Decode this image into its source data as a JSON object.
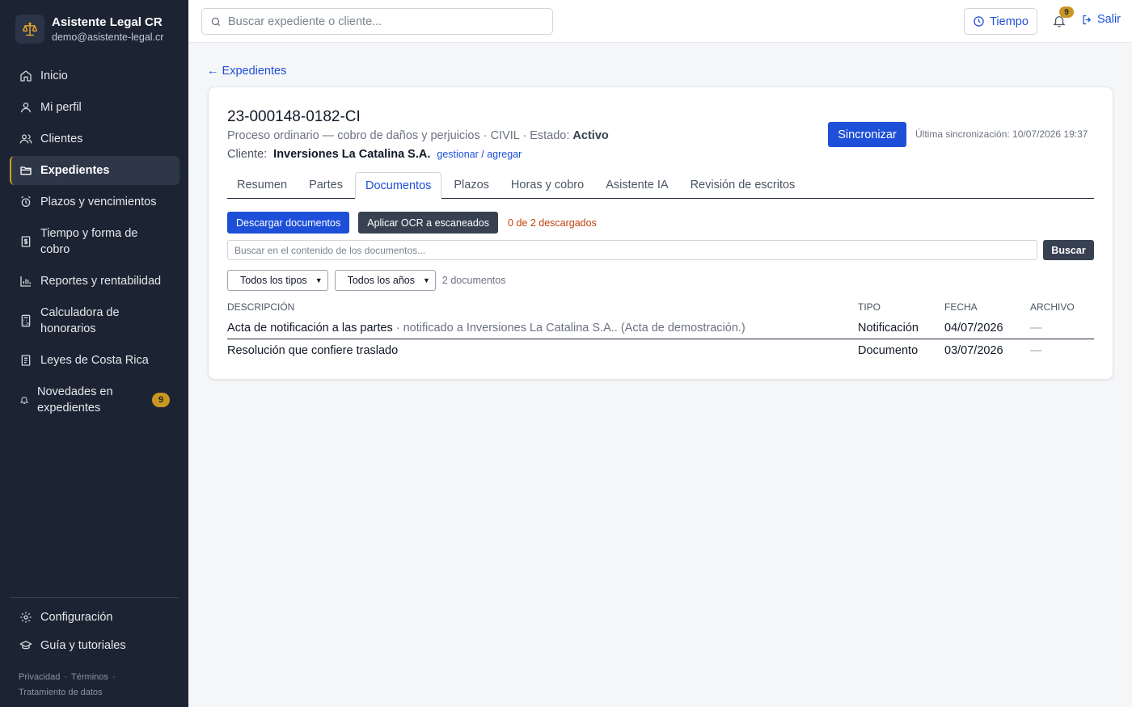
{
  "brand": {
    "title": "Asistente Legal CR",
    "email": "demo@asistente-legal.cr",
    "icon": "scale-icon"
  },
  "sidebar": {
    "items": [
      {
        "label": "Inicio",
        "icon": "home-icon"
      },
      {
        "label": "Mi perfil",
        "icon": "user-icon"
      },
      {
        "label": "Clientes",
        "icon": "users-icon"
      },
      {
        "label": "Expedientes",
        "icon": "folder-icon",
        "active": true
      },
      {
        "label": "Plazos y vencimientos",
        "icon": "alarm-clock-icon"
      },
      {
        "label": "Tiempo y forma de cobro",
        "icon": "billing-icon"
      },
      {
        "label": "Reportes y rentabilidad",
        "icon": "bar-chart-icon"
      },
      {
        "label": "Calculadora de honorarios",
        "icon": "calculator-icon"
      },
      {
        "label": "Leyes de Costa Rica",
        "icon": "book-icon"
      },
      {
        "label": "Novedades en expedientes",
        "icon": "bell-icon",
        "badge": "9"
      }
    ],
    "bottom": [
      {
        "label": "Configuración",
        "icon": "gear-icon"
      },
      {
        "label": "Guía y tutoriales",
        "icon": "graduation-cap-icon"
      }
    ],
    "legal": {
      "privacy": "Privacidad",
      "terms": "Términos",
      "data": "Tratamiento de datos"
    }
  },
  "topbar": {
    "search_placeholder": "Buscar expediente o cliente...",
    "tiempo_label": "Tiempo",
    "notifications_count": "9",
    "salir_label": "Salir"
  },
  "back_link": "← Expedientes",
  "expediente": {
    "number": "23-000148-0182-CI",
    "subtitle": "Proceso ordinario — cobro de daños y perjuicios · CIVIL · Estado: ",
    "status": "Activo",
    "client_label": "Cliente:",
    "client_name": "Inversiones La Catalina S.A.",
    "manage_link": "gestionar / agregar",
    "sync_button": "Sincronizar",
    "last_sync": "Última sincronización: 10/07/2026 19:37"
  },
  "tabs": [
    "Resumen",
    "Partes",
    "Documentos",
    "Plazos",
    "Horas y cobro",
    "Asistente IA",
    "Revisión de escritos"
  ],
  "active_tab": "Documentos",
  "documents": {
    "download_button": "Descargar documentos",
    "ocr_button": "Aplicar OCR a escaneados",
    "download_status": "0 de 2 descargados",
    "search_placeholder": "Buscar en el contenido de los documentos...",
    "search_button": "Buscar",
    "filter_type": "Todos los tipos",
    "filter_year": "Todos los años",
    "count": "2 documentos",
    "columns": [
      "DESCRIPCIÓN",
      "TIPO",
      "FECHA",
      "ARCHIVO"
    ],
    "rows": [
      {
        "title": "Acta de notificación a las partes",
        "note": " · notificado a Inversiones La Catalina S.A.. (Acta de demostración.)",
        "type": "Notificación",
        "date": "04/07/2026",
        "file": "—"
      },
      {
        "title": "Resolución que confiere traslado",
        "note": "",
        "type": "Documento",
        "date": "03/07/2026",
        "file": "—"
      }
    ]
  },
  "colors": {
    "sidebar_bg": "#1c2433",
    "accent_blue": "#1d4fd8",
    "badge_gold": "#c99622",
    "dark_button": "#374151",
    "status_orange": "#c2410c"
  }
}
